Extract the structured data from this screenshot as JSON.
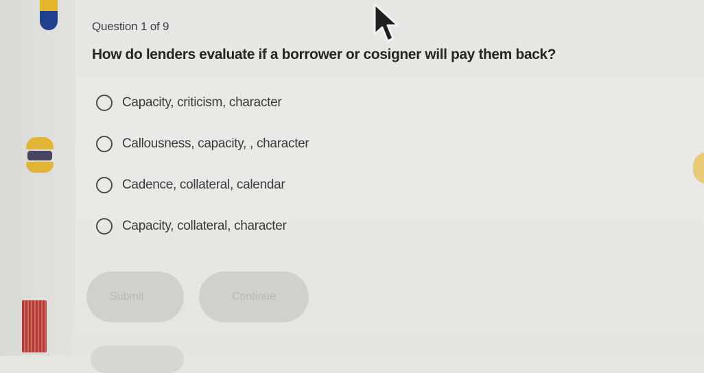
{
  "quiz": {
    "counter": "Question 1 of 9",
    "question": "How do lenders evaluate if a borrower or cosigner will pay them back?",
    "options": [
      "Capacity, criticism, character",
      "Callousness, capacity, , character",
      "Cadence, collateral, calendar",
      "Capacity, collateral, character"
    ],
    "selected_index": null
  },
  "buttons": {
    "submit_label": "Submit",
    "continue_label": "Continue"
  },
  "icons": {
    "cursor": "arrow-cursor-icon",
    "radio": "radio-unselected-icon"
  },
  "colors": {
    "background": "#e7e7e4",
    "button_disabled": "#d0d0cd",
    "text": "#262626"
  }
}
